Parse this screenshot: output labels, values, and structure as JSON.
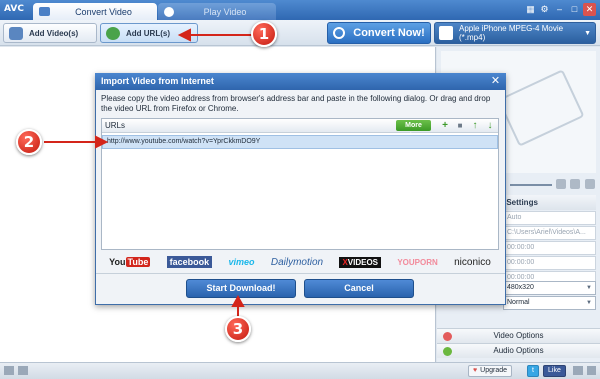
{
  "app": {
    "logo": "AVC"
  },
  "tabs": [
    {
      "label": "Convert Video",
      "active": true
    },
    {
      "label": "Play Video",
      "active": false
    }
  ],
  "window_controls": [
    "info-icon",
    "gear-icon",
    "minimize-icon",
    "maximize-icon",
    "close-icon"
  ],
  "toolbar": {
    "add_videos_label": "Add Video(s)",
    "add_url_label": "Add URL(s)",
    "convert_label": "Convert Now!",
    "profile_label": "Apple iPhone MPEG-4 Movie (*.mp4)",
    "profile_arrow": "▼"
  },
  "settings": {
    "header": "sic Settings",
    "rows": [
      "Auto",
      "C:\\Users\\Ariel\\Videos\\A...",
      "00:00:00",
      "00:00:00",
      "00:00:00"
    ],
    "resolution": "480x320",
    "quality": "Normal",
    "select_arrow": "▼"
  },
  "options": {
    "video_label": "Video Options",
    "audio_label": "Audio Options"
  },
  "statusbar": {
    "upgrade_label": "Upgrade",
    "twitter_label": "t",
    "like_label": "Like"
  },
  "dialog": {
    "title": "Import Video from Internet",
    "close": "✕",
    "instructions": "Please copy the video address from browser's address bar and paste in the following dialog. Or drag and drop the video URL from Firefox or Chrome.",
    "urls_header": "URLs",
    "more_sites_label": "More Sites",
    "url_icons": {
      "add": "+",
      "delete": "■",
      "up": "↑",
      "down": "↓"
    },
    "url_value": "http://www.youtube.com/watch?v=YprCkkmDO9Y",
    "sites": {
      "youtube": [
        "You",
        "Tube"
      ],
      "facebook": "facebook",
      "vimeo": "vimeo",
      "dailymotion": "Dailymotion",
      "xvideos": [
        "X",
        "VIDEOS"
      ],
      "youporn": "YOUPORN",
      "niconico": "niconico"
    },
    "start_label": "Start Download!",
    "cancel_label": "Cancel"
  },
  "annotations": {
    "step1": "1",
    "step2": "2",
    "step3": "3",
    "accent": "#d4251a"
  }
}
